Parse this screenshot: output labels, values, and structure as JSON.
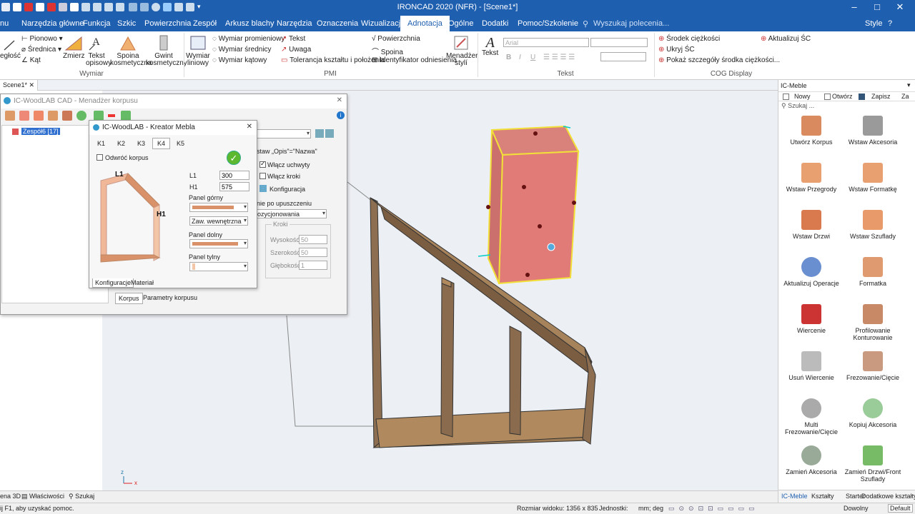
{
  "app": {
    "title": "IRONCAD 2020 (NFR) - [Scene1*]",
    "style_label": "Style"
  },
  "colors": {
    "accent": "#1f5fb0",
    "wood": "#b08a5e",
    "selection": "#e07b78",
    "highlight": "#f2e038"
  },
  "menu": [
    "nu",
    "Narzędzia główne",
    "Funkcja",
    "Szkic",
    "Powierzchnia",
    "Zespół",
    "Arkusz blachy",
    "Narzędzia",
    "Oznaczenia",
    "Wizualizacja",
    "Adnotacja",
    "Ogólne",
    "Dodatki",
    "Pomoc/Szkolenie"
  ],
  "search_placeholder": "Wyszukaj polecenia...",
  "ribbon": {
    "wymiar": {
      "group": "Wymiar",
      "partial": "egłość",
      "pionowo": "Pionowo",
      "srednica": "Średnica",
      "kat": "Kąt",
      "zmierz": "Zmierz",
      "tekst_opisowy": "Tekst opisowy",
      "spoina_kosm": "Spoina kosmetyczna",
      "gwint": "Gwint kosmetyczny"
    },
    "pmi": {
      "group": "PMI",
      "wymiar_liniowy": "Wymiar liniowy",
      "promieniowy": "Wymiar promieniowy",
      "srednicy": "Wymiar średnicy",
      "katowy": "Wymiar kątowy",
      "tekst": "Tekst",
      "uwaga": "Uwaga",
      "tolerancja": "Tolerancja kształtu i położenia",
      "powierzchnia": "Powierzchnia",
      "spoina": "Spoina",
      "identyfikator": "Identyfikator odniesienia",
      "menadzer": "Menadżer stylí"
    },
    "tekst": {
      "group": "Tekst",
      "label": "Tekst",
      "font": "Arial",
      "bold": "B",
      "italic": "I",
      "underline": "U"
    },
    "cog": {
      "group": "COG Display",
      "srodek": "Środek ciężkości",
      "ukryj": "Ukryj ŚC",
      "pokaz": "Pokaż szczegóły środka ciężkości...",
      "aktualizuj": "Aktualizuj ŚC"
    }
  },
  "doc_tab": "Scene1*",
  "manager": {
    "title": "IC-WoodLAB CAD - Menadżer korpusu",
    "tree_item": "Zespół6 [17]",
    "opis": "staw „Opis”=\"Nazwa\"",
    "uchwyty": "Włącz uchwyty",
    "kroki": "Włącz kroki",
    "konfiguracja": "Konfiguracja",
    "upuszczeniu": "nie po upuszczeniu",
    "pozycjonowania": "ozycjonowania",
    "kroki_group": "Kroki",
    "wysokosc": "Wysokość",
    "wysokosc_val": "50",
    "szerokosc": "Szerokość",
    "szerokosc_val": "50",
    "glebokosc": "Głębokość",
    "glebokosc_val": "1",
    "tab_korpus": "Korpus",
    "tab_parametry": "Parametry korpusu"
  },
  "kreator": {
    "title": "IC-WoodLAB - Kreator Mebla",
    "tabs": [
      "K1",
      "K2",
      "K3",
      "K4",
      "K5"
    ],
    "odwroc": "Odwróć korpus",
    "diagram_L1": "L1",
    "diagram_H1": "H1",
    "L1_label": "L1",
    "L1_value": "300",
    "H1_label": "H1",
    "H1_value": "575",
    "panel_gorny": "Panel górny",
    "zaw": "Zaw. wewnętrzna",
    "panel_dolny": "Panel dolny",
    "panel_tylny": "Panel tylny",
    "tab_konf": "Konfiguracje",
    "tab_mat": "Materiał"
  },
  "right_panel": {
    "title": "IC-Meble",
    "nowy": "Nowy",
    "otworz": "Otwórz",
    "zapisz": "Zapisz",
    "za": "Za",
    "search": "Szukaj ...",
    "items": [
      "Utwórz Korpus",
      "Wstaw Akcesoria",
      "Wstaw Przegrody",
      "Wstaw Formatkę",
      "Wstaw Drzwi",
      "Wstaw Szuflady",
      "Aktualizuj Operacje",
      "Formatka",
      "Wiercenie",
      "Profilowanie Konturowanie",
      "Usuń Wiercenie",
      "Frezowanie/Cięcie",
      "Multi Frezowanie/Cięcie",
      "Kopiuj Akcesoria",
      "Zamień Akcesoria",
      "Zamień Drzwi/Front Szuflady"
    ],
    "bottom_tabs": [
      "IC-Meble",
      "Kształty",
      "Starter",
      "Dodatkowe kształty"
    ]
  },
  "bottom_tabs": [
    "ena 3D",
    "Właściwości",
    "Szukaj"
  ],
  "status": {
    "hint": "ij F1, aby uzyskać pomoc.",
    "size": "Rozmiar widoku: 1356 x 835",
    "units_label": "Jednostki:",
    "units": "mm; deg",
    "dowolny": "Dowolny",
    "default": "Default"
  },
  "axis": {
    "z": "z",
    "x": "x"
  }
}
